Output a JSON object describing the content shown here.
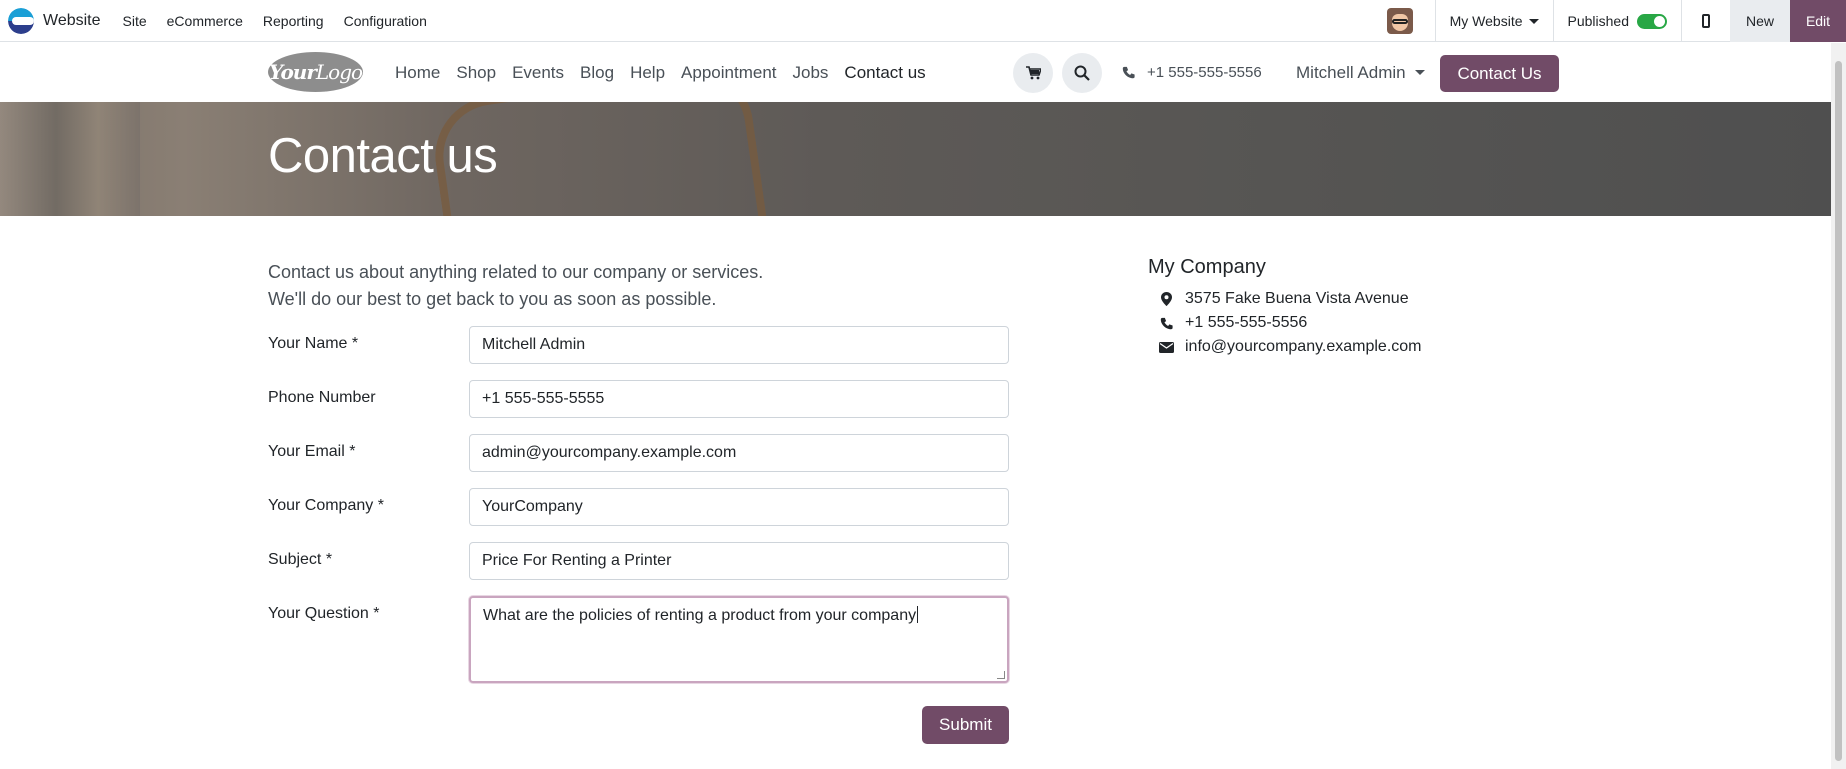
{
  "adminbar": {
    "brand": "Website",
    "menu": [
      "Site",
      "eCommerce",
      "Reporting",
      "Configuration"
    ],
    "website_selector": "My Website",
    "published_label": "Published",
    "published": true,
    "new_label": "New",
    "edit_label": "Edit"
  },
  "header": {
    "logo_text_bold": "Your",
    "logo_text": "Logo",
    "nav": [
      "Home",
      "Shop",
      "Events",
      "Blog",
      "Help",
      "Appointment",
      "Jobs",
      "Contact us"
    ],
    "active_nav": "Contact us",
    "phone": "+1 555-555-5556",
    "user": "Mitchell Admin",
    "cta": "Contact Us"
  },
  "hero": {
    "title": "Contact us"
  },
  "intro": {
    "line1": "Contact us about anything related to our company or services.",
    "line2": "We'll do our best to get back to you as soon as possible."
  },
  "form": {
    "fields": [
      {
        "label": "Your Name *",
        "value": "Mitchell Admin"
      },
      {
        "label": "Phone Number",
        "value": "+1 555-555-5555"
      },
      {
        "label": "Your Email *",
        "value": "admin@yourcompany.example.com"
      },
      {
        "label": "Your Company *",
        "value": "YourCompany"
      },
      {
        "label": "Subject *",
        "value": "Price For Renting a Printer"
      },
      {
        "label": "Your Question *",
        "value": "What are the policies of renting a product from your company"
      }
    ],
    "submit_label": "Submit"
  },
  "company": {
    "name": "My Company",
    "address": "3575 Fake Buena Vista Avenue",
    "phone": "+1 555-555-5556",
    "email": "info@yourcompany.example.com"
  },
  "colors": {
    "primary": "#714b67",
    "toggle_on": "#28a745"
  }
}
